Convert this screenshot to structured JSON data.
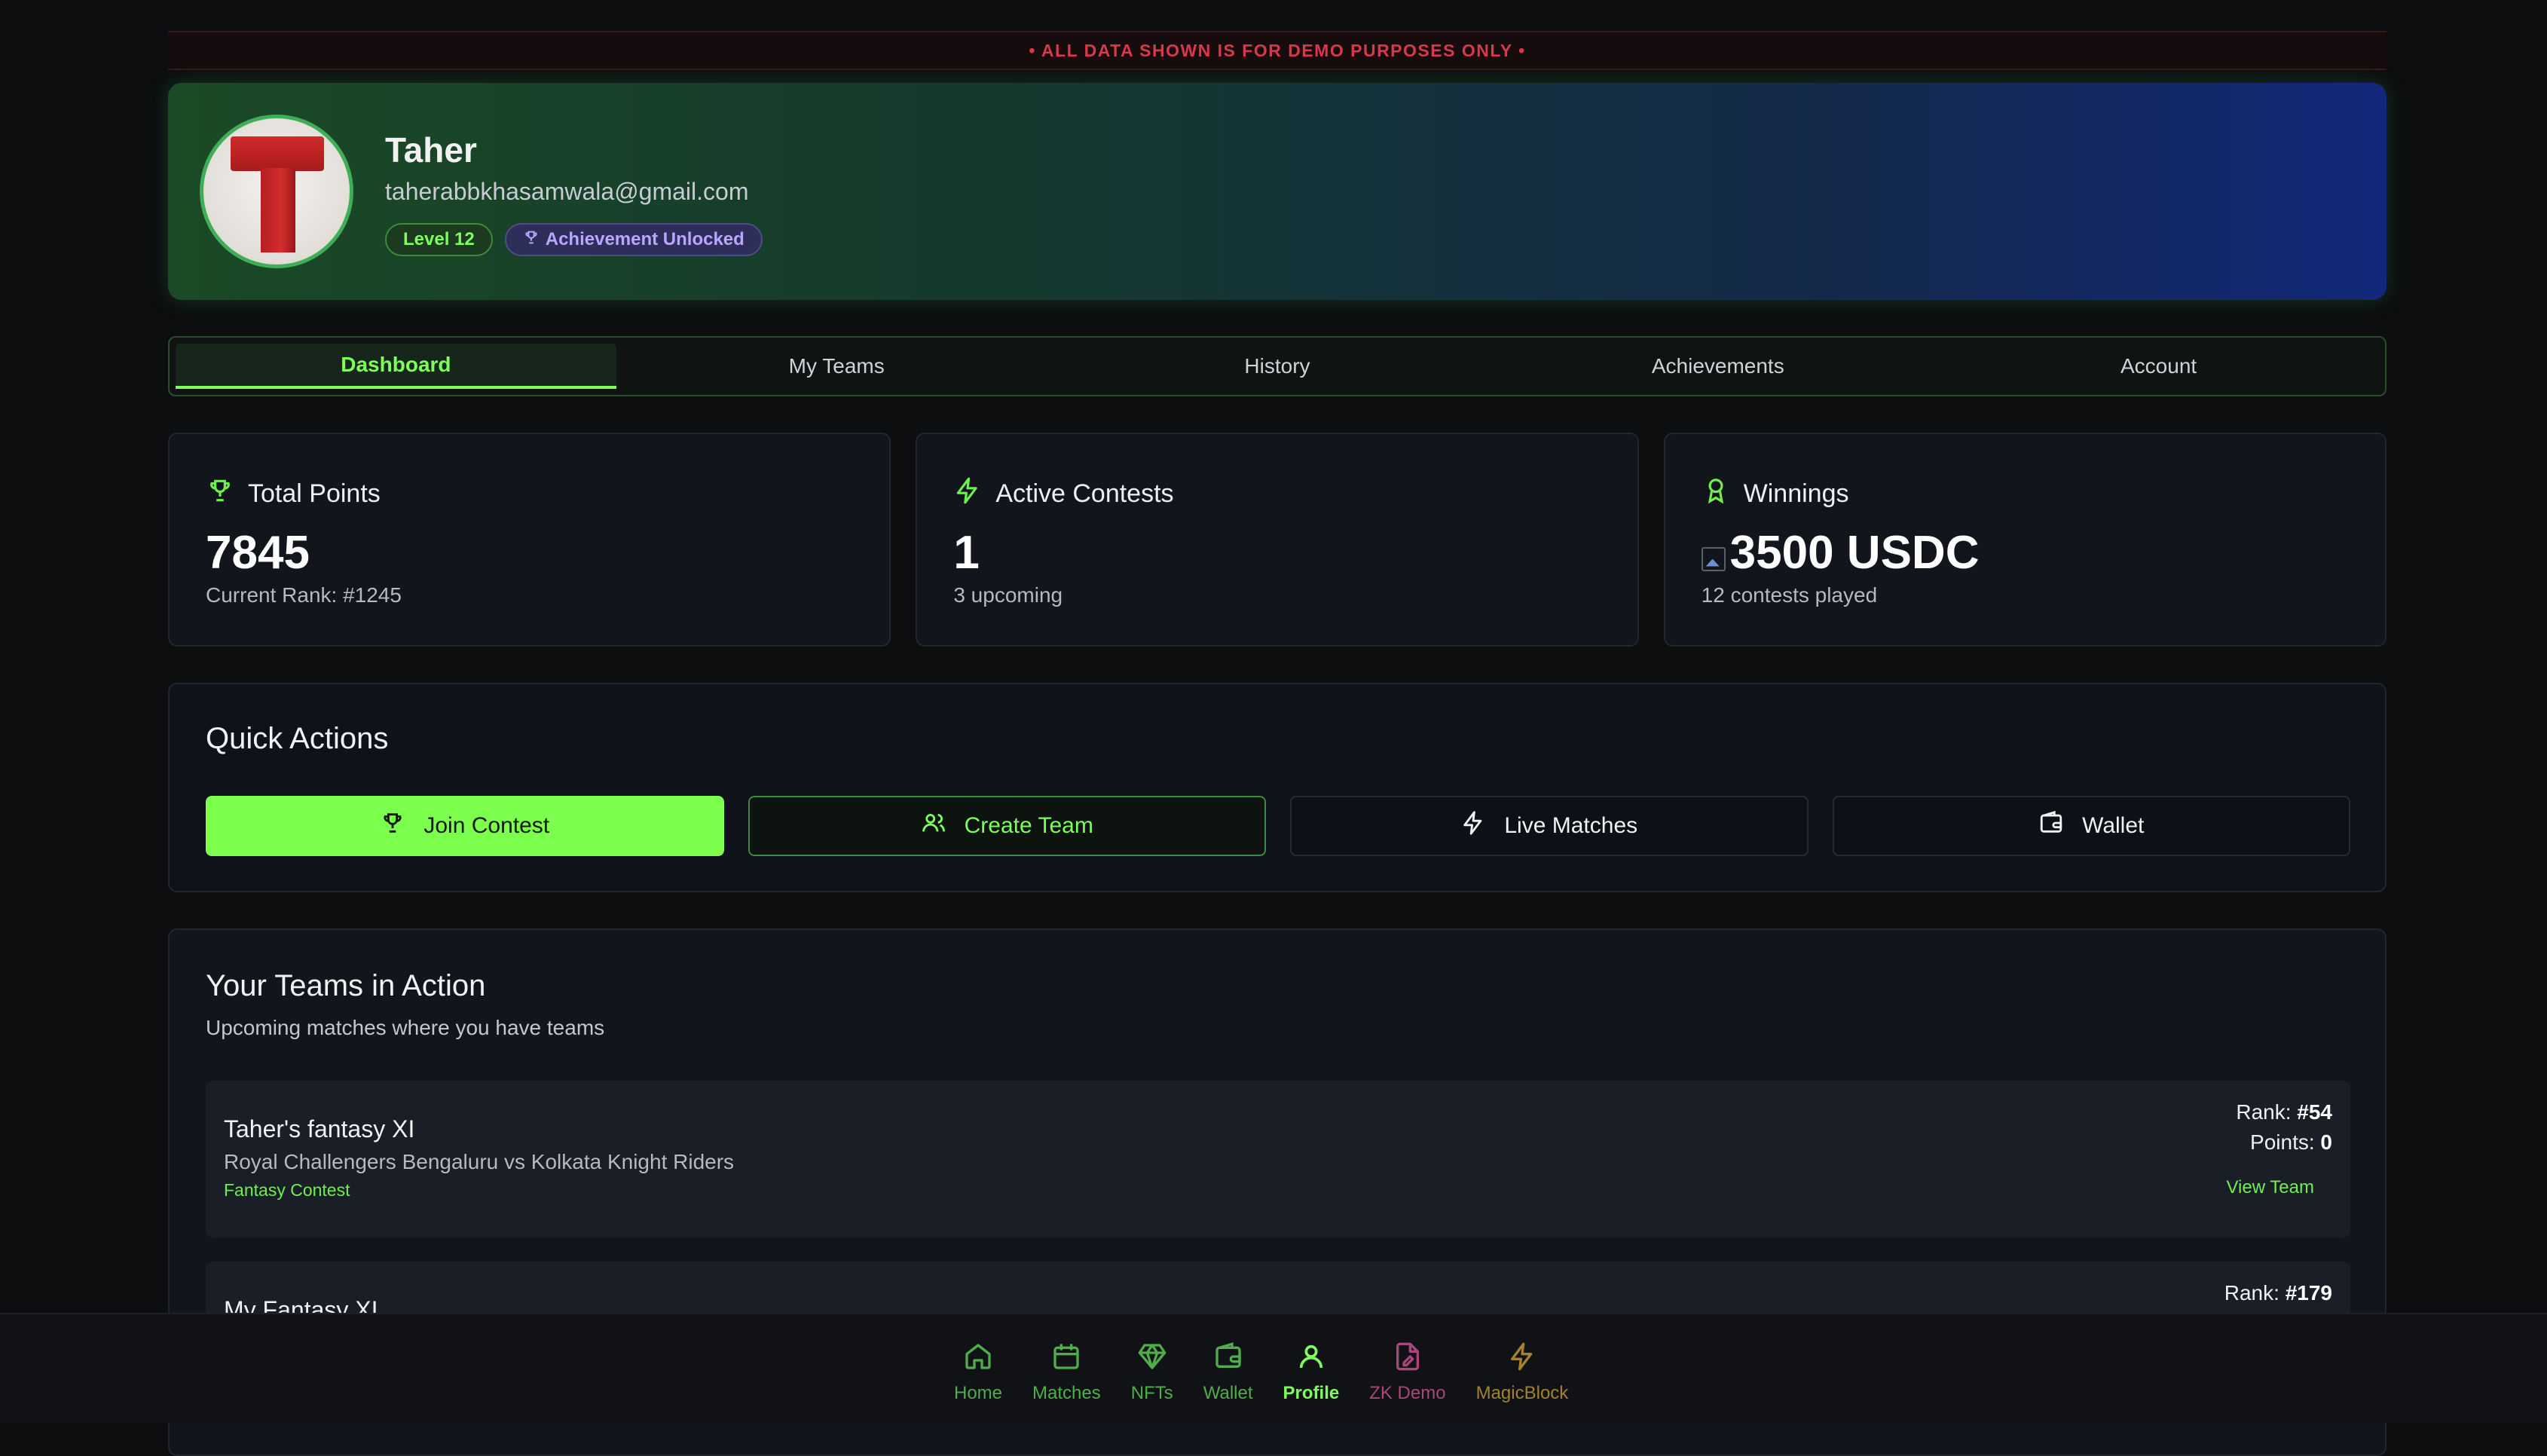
{
  "banner": {
    "text": "• ALL DATA SHOWN IS FOR DEMO PURPOSES ONLY •"
  },
  "profile": {
    "name": "Taher",
    "email": "taherabbkhasamwala@gmail.com",
    "level_badge": "Level 12",
    "achievement_badge": "Achievement Unlocked"
  },
  "tabs": [
    "Dashboard",
    "My Teams",
    "History",
    "Achievements",
    "Account"
  ],
  "active_tab": "Dashboard",
  "stats": [
    {
      "icon": "trophy-icon",
      "title": "Total Points",
      "value": "7845",
      "sub": "Current Rank: #1245"
    },
    {
      "icon": "lightning-icon",
      "title": "Active Contests",
      "value": "1",
      "sub": "3 upcoming"
    },
    {
      "icon": "award-icon",
      "title": "Winnings",
      "value": "3500 USDC",
      "sub": "12 contests played"
    }
  ],
  "quick_actions": {
    "title": "Quick Actions",
    "buttons": [
      {
        "label": "Join Contest",
        "icon": "trophy-icon"
      },
      {
        "label": "Create Team",
        "icon": "users-icon"
      },
      {
        "label": "Live Matches",
        "icon": "lightning-icon"
      },
      {
        "label": "Wallet",
        "icon": "wallet-icon"
      }
    ]
  },
  "teams_section": {
    "title": "Your Teams in Action",
    "subtitle": "Upcoming matches where you have teams",
    "rank_label": "Rank:",
    "points_label": "Points:",
    "teams": [
      {
        "name": "Taher's fantasy XI",
        "match": "Royal Challengers Bengaluru vs Kolkata Knight Riders",
        "type": "Fantasy Contest",
        "rank": "#54",
        "points": "0",
        "action": "View Team"
      },
      {
        "name": "My Fantasy XI",
        "rank": "#179"
      }
    ]
  },
  "bottom_nav": [
    {
      "label": "Home",
      "icon": "home-icon"
    },
    {
      "label": "Matches",
      "icon": "calendar-icon"
    },
    {
      "label": "NFTs",
      "icon": "diamond-icon"
    },
    {
      "label": "Wallet",
      "icon": "wallet-icon"
    },
    {
      "label": "Profile",
      "icon": "user-icon",
      "active": true
    },
    {
      "label": "ZK Demo",
      "icon": "file-signature-icon"
    },
    {
      "label": "MagicBlock",
      "icon": "lightning-icon"
    }
  ],
  "colors": {
    "accent": "#7dff5c",
    "banner_red": "#d8384a",
    "zk_pink": "#a8477a",
    "magicblock_gold": "#a4822c"
  }
}
